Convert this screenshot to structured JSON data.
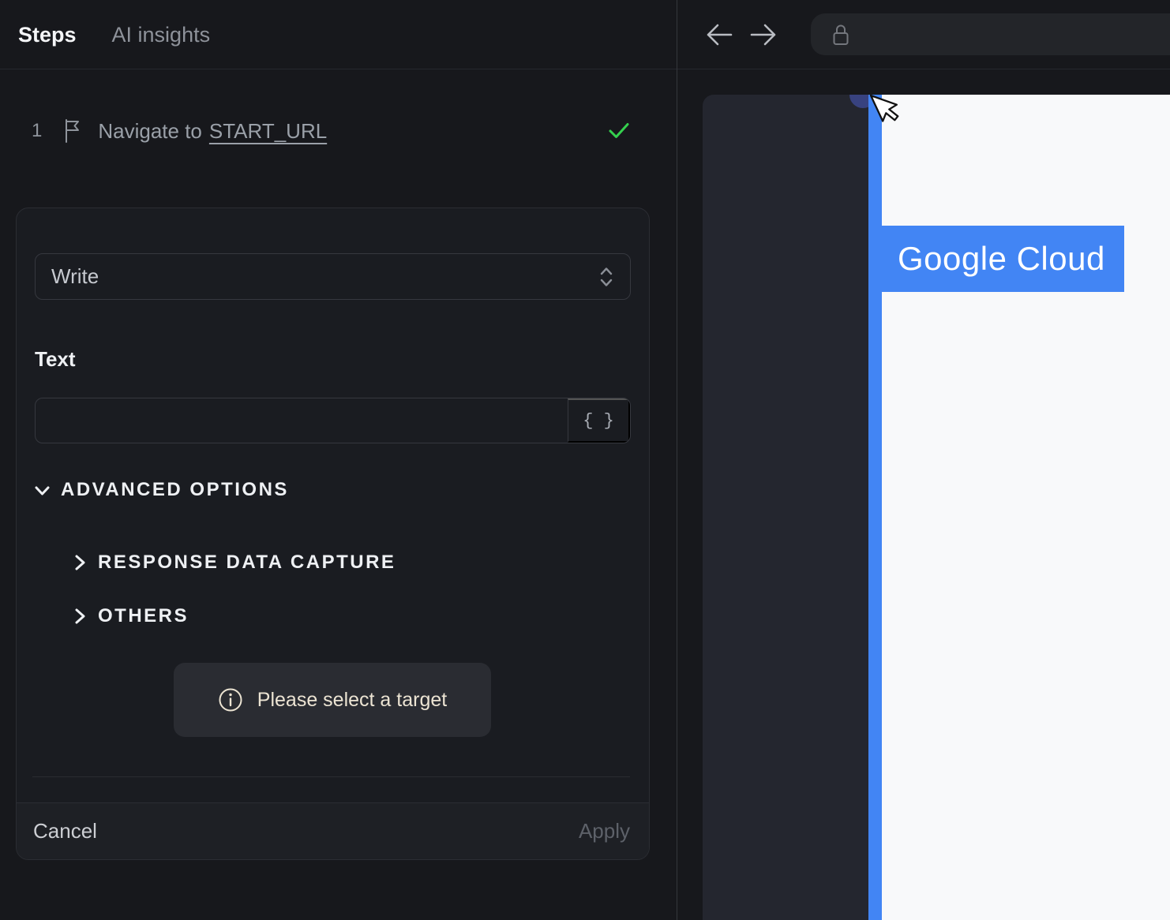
{
  "left_panel": {
    "tabs": {
      "steps": "Steps",
      "ai_insights": "AI insights"
    },
    "step": {
      "number": "1",
      "action_text": "Navigate to",
      "target_link": "START_URL",
      "status_icon": "green-checkmark"
    },
    "editor": {
      "action_select": {
        "value": "Write"
      },
      "text_field": {
        "label": "Text",
        "value": "",
        "placeholder": "",
        "variables_button": "{ }"
      },
      "advanced_options": {
        "label": "ADVANCED OPTIONS"
      },
      "sections": {
        "response_data_capture": "RESPONSE DATA CAPTURE",
        "others": "OTHERS"
      },
      "notice": {
        "message": "Please select a target"
      },
      "footer": {
        "cancel": "Cancel",
        "apply": "Apply"
      }
    }
  },
  "browser_panel": {
    "nav": {
      "back_icon": "arrow-left",
      "forward_icon": "arrow-right",
      "address_bar": {
        "lock_icon": "lock",
        "value": ""
      }
    },
    "preview": {
      "brand": "Google Cloud"
    }
  },
  "colors": {
    "accent_blue": "#4285f4",
    "success_green": "#35d04e",
    "notice_text": "#ece4d3",
    "preview_sidebar": "#24262f",
    "page_background": "#f8f9fa"
  }
}
